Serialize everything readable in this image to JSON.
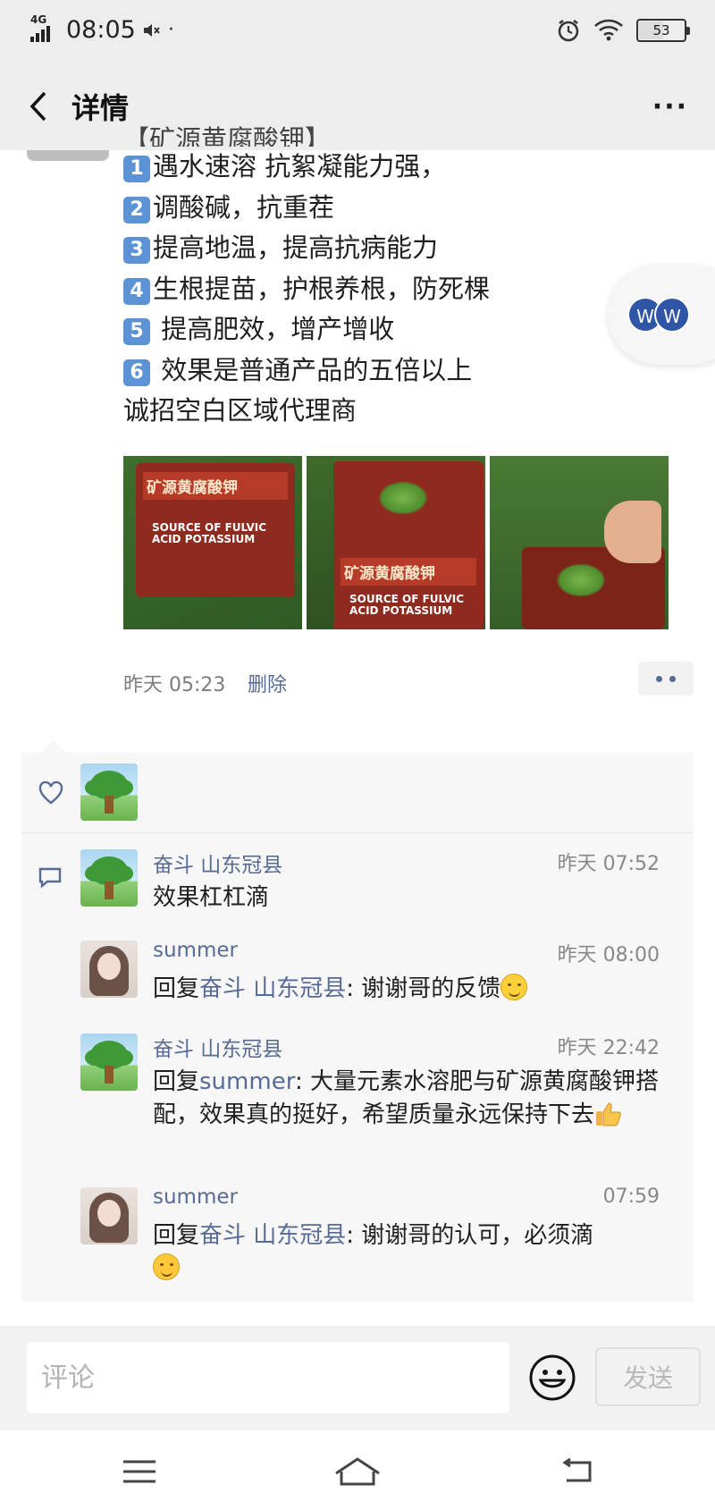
{
  "status": {
    "network": "4G",
    "time": "08:05",
    "extra": "·",
    "battery": "53",
    "battery_level_percent": 53
  },
  "header": {
    "title": "详情"
  },
  "post": {
    "lines": [
      "【矿源黄腐酸钾】",
      "遇水速溶 抗絮凝能力强，",
      "调酸碱，抗重茬",
      "提高地温，提高抗病能力",
      "生根提苗，护根养根，防死棵",
      " 提高肥效，增产增收",
      " 效果是普通产品的五倍以上",
      "诚招空白区域代理商"
    ],
    "numbers": [
      "1",
      "2",
      "3",
      "4",
      "5",
      "6"
    ],
    "photos": {
      "bag_label": "矿源黄腐酸钾",
      "bag_english": "SOURCE OF FULVIC ACID POTASSIUM"
    },
    "timestamp": "昨天 05:23",
    "delete_label": "删除"
  },
  "floating": {
    "letter1": "W",
    "letter2": "W"
  },
  "comments": [
    {
      "name": "奋斗  山东冠县",
      "time": "昨天 07:52",
      "text": "效果杠杠滴"
    },
    {
      "name": "summer",
      "time": "昨天 08:00",
      "prefix": "回复",
      "reply_to": "奋斗  山东冠县",
      "text": ": 谢谢哥的反馈"
    },
    {
      "name": "奋斗  山东冠县",
      "time": "昨天 22:42",
      "prefix": "回复",
      "reply_to": "summer",
      "text": ": 大量元素水溶肥与矿源黄腐酸钾搭配，效果真的挺好，希望质量永远保持下去"
    },
    {
      "name": "summer",
      "time": "07:59",
      "prefix": "回复",
      "reply_to": "奋斗  山东冠县",
      "text": ": 谢谢哥的认可，必须滴"
    }
  ],
  "comment_bar": {
    "placeholder": "评论",
    "send_label": "发送"
  },
  "colors": {
    "link": "#576b95",
    "accent_badge": "#5b93d6"
  }
}
